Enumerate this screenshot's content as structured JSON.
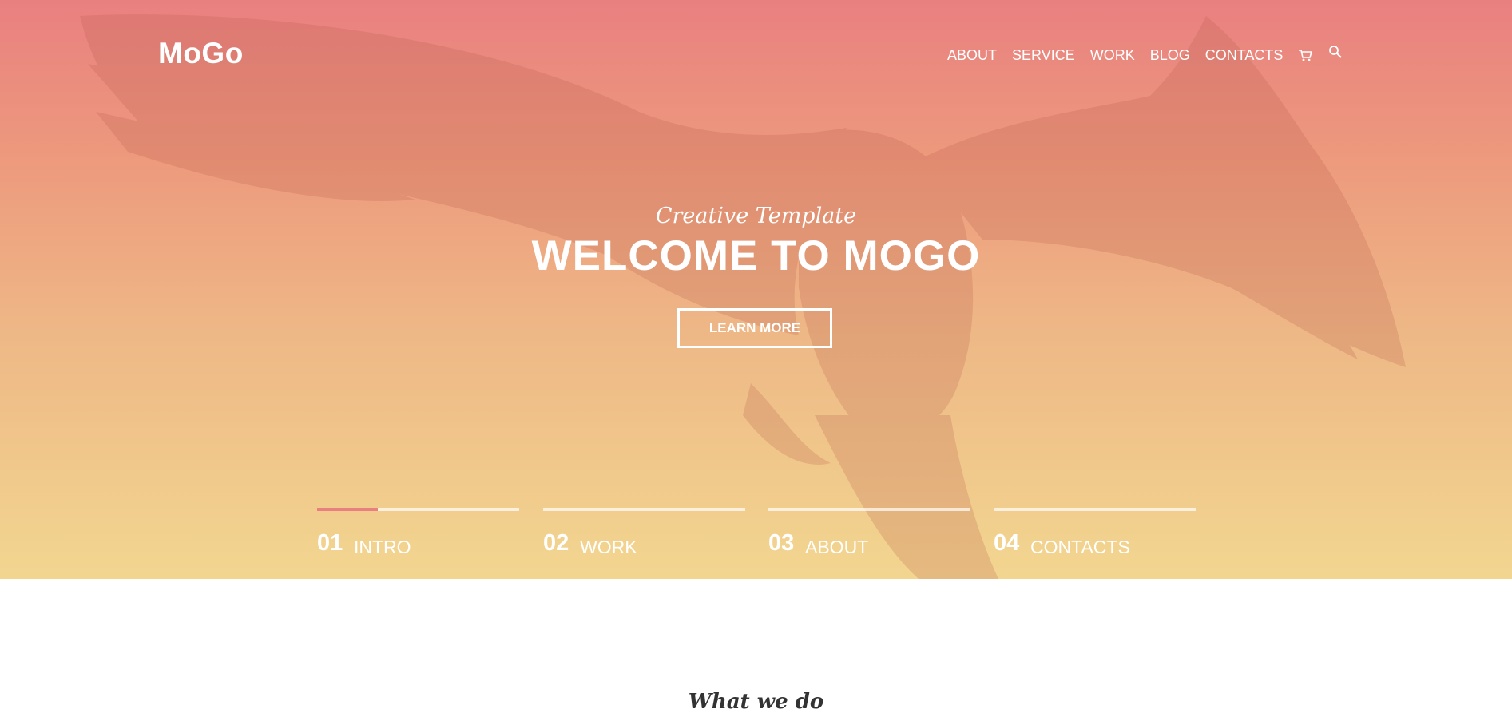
{
  "header": {
    "logo": "MoGo",
    "nav": [
      {
        "label": "ABOUT"
      },
      {
        "label": "SERVICE"
      },
      {
        "label": "WORK"
      },
      {
        "label": "BLOG"
      },
      {
        "label": "CONTACTS"
      }
    ],
    "icons": [
      "cart-icon",
      "search-icon"
    ]
  },
  "hero": {
    "subtitle": "Creative Template",
    "title": "WELCOME TO MOGO",
    "cta_label": "LEARN MORE",
    "background_image": "eagle",
    "gradient_colors": [
      "#e98080",
      "#f2d690"
    ]
  },
  "slider": {
    "items": [
      {
        "num": "01",
        "label": "INTRO",
        "progress": 0.3
      },
      {
        "num": "02",
        "label": "WORK",
        "progress": 0
      },
      {
        "num": "03",
        "label": "ABOUT",
        "progress": 0
      },
      {
        "num": "04",
        "label": "CONTACTS",
        "progress": 0
      }
    ],
    "active_color": "#e98080"
  },
  "section": {
    "heading": "What we do"
  }
}
